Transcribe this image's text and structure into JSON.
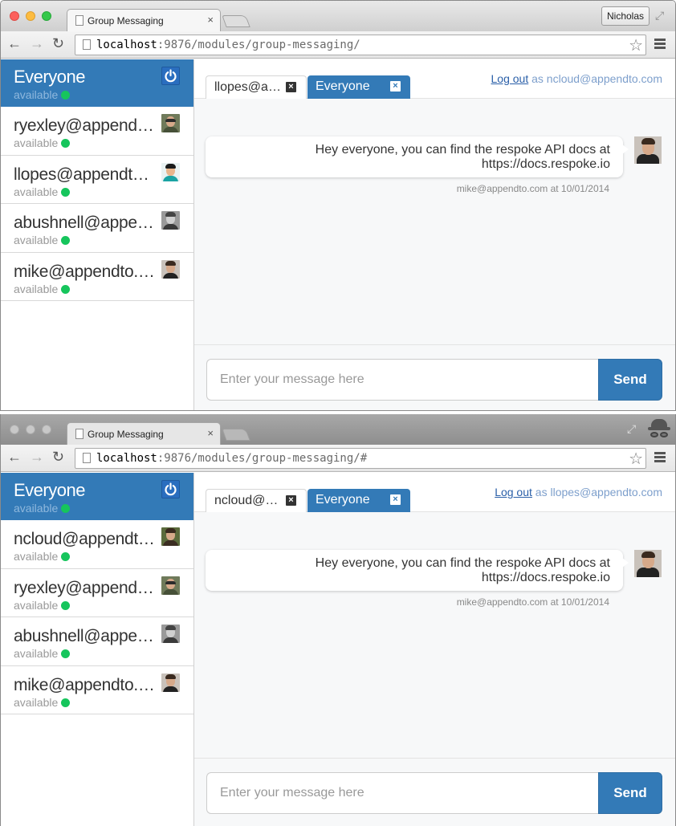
{
  "windows": [
    {
      "browser": {
        "tab_title": "Group Messaging",
        "tab_close": "×",
        "profile_name": "Nicholas",
        "url_host": "localhost",
        "url_rest": ":9876/modules/group-messaging/"
      },
      "group": {
        "name": "Everyone",
        "status": "available"
      },
      "users": [
        {
          "name": "ryexley@appendto.com",
          "status": "available"
        },
        {
          "name": "llopes@appendto.com",
          "status": "available"
        },
        {
          "name": "abushnell@appendto.com",
          "status": "available"
        },
        {
          "name": "mike@appendto.com",
          "status": "available"
        }
      ],
      "tabs": {
        "inactive": "llopes@appendto.com",
        "active": "Everyone",
        "close": "×"
      },
      "logout": {
        "link": "Log out",
        "as": "as ncloud@appendto.com"
      },
      "message": {
        "line1": "Hey everyone, you can find the respoke API docs at",
        "line2": "https://docs.respoke.io",
        "meta": "mike@appendto.com at 10/01/2014"
      },
      "composer": {
        "placeholder": "Enter your message here",
        "send": "Send"
      }
    },
    {
      "browser": {
        "tab_title": "Group Messaging",
        "tab_close": "×",
        "url_host": "localhost",
        "url_rest": ":9876/modules/group-messaging/#"
      },
      "group": {
        "name": "Everyone",
        "status": "available"
      },
      "users": [
        {
          "name": "ncloud@appendto.com",
          "status": "available"
        },
        {
          "name": "ryexley@appendto.com",
          "status": "available"
        },
        {
          "name": "abushnell@appendto.com",
          "status": "available"
        },
        {
          "name": "mike@appendto.com",
          "status": "available"
        }
      ],
      "tabs": {
        "inactive": "ncloud@appendto.com",
        "active": "Everyone",
        "close": "×"
      },
      "logout": {
        "link": "Log out",
        "as": "as llopes@appendto.com"
      },
      "message": {
        "line1": "Hey everyone, you can find the respoke API docs at",
        "line2": "https://docs.respoke.io",
        "meta": "mike@appendto.com at 10/01/2014"
      },
      "composer": {
        "placeholder": "Enter your message here",
        "send": "Send"
      }
    }
  ],
  "colors": {
    "brand_blue": "#337ab7",
    "available_green": "#16c55c",
    "link_blue": "#2a5fa8"
  },
  "icons": [
    "document-icon",
    "close-icon",
    "back-arrow-icon",
    "forward-arrow-icon",
    "reload-icon",
    "bookmark-star-icon",
    "menu-icon",
    "power-icon",
    "fullscreen-icon",
    "incognito-icon"
  ]
}
